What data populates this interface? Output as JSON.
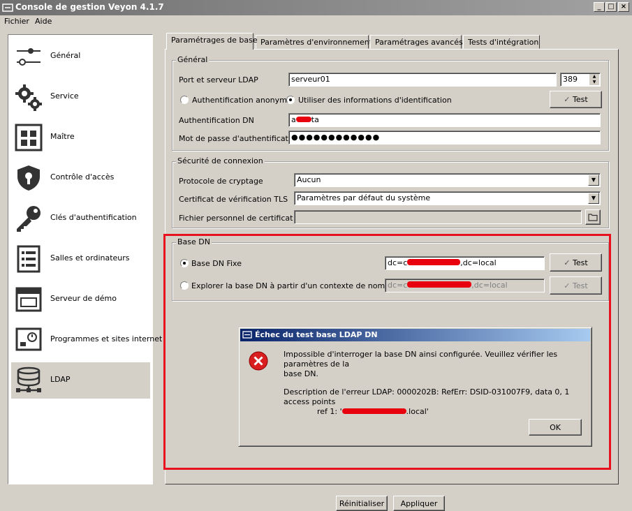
{
  "window": {
    "title": "Console de gestion Veyon 4.1.7"
  },
  "menu": [
    "Fichier",
    "Aide"
  ],
  "sidebar": {
    "items": [
      {
        "label": "Général",
        "icon": "sliders-icon"
      },
      {
        "label": "Service",
        "icon": "gears-icon"
      },
      {
        "label": "Maître",
        "icon": "grid-icon"
      },
      {
        "label": "Contrôle d'accès",
        "icon": "shield-lock-icon"
      },
      {
        "label": "Clés d'authentification",
        "icon": "key-icon"
      },
      {
        "label": "Salles et ordinateurs",
        "icon": "list-icon"
      },
      {
        "label": "Serveur de démo",
        "icon": "window-icon"
      },
      {
        "label": "Programmes et sites internet",
        "icon": "screen-clock-icon"
      },
      {
        "label": "LDAP",
        "icon": "database-network-icon",
        "selected": true
      }
    ]
  },
  "tabs": [
    "Paramétrages de base",
    "Paramètres d'environnement",
    "Paramétrages avancés",
    "Tests d'intégration"
  ],
  "general": {
    "title": "Général",
    "server_label": "Port et serveur LDAP",
    "server_value": "serveur01",
    "port_value": "389",
    "anon_label": "Authentification anonyme",
    "cred_label": "Utiliser des informations d'identification",
    "test_label": "Test",
    "dn_label": "Authentification DN",
    "dn_value_a": "a",
    "dn_value_b": "ta",
    "pw_label": "Mot de passe d'authentification",
    "pw_value": "●●●●●●●●●●●●"
  },
  "security": {
    "title": "Sécurité de connexion",
    "crypto_label": "Protocole de cryptage",
    "crypto_value": "Aucun",
    "tls_label": "Certificat de vérification TLS",
    "tls_value": "Paramètres par défaut du système",
    "ca_label": "Fichier personnel de certificat CA"
  },
  "basedn": {
    "title": "Base DN",
    "fixed_label": "Base DN Fixe",
    "fixed_value_a": "dc=c",
    "fixed_value_b": ",dc=local",
    "browse_label": "Explorer la base DN à partir d'un contexte de nommage",
    "browse_value_a": "dc=c",
    "browse_value_b": ",dc=local",
    "test_label": "Test"
  },
  "dialog": {
    "title": "Échec du test base LDAP DN",
    "line1": "Impossible d'interroger la base DN ainsi configurée. Veuillez vérifier les paramètres de la",
    "line2": "base DN.",
    "line3": "Description de l'erreur LDAP: 0000202B: RefErr: DSID-031007F9, data 0, 1 access points",
    "line4a": "ref 1: '",
    "line4b": ".local'",
    "ok_label": "OK"
  },
  "footer": {
    "reset_label": "Réinitialiser",
    "apply_label": "Appliquer"
  },
  "colors": {
    "highlight_frame": "#e8121f",
    "redaction": "#e8000e",
    "dialog_title": "#0a246a"
  }
}
